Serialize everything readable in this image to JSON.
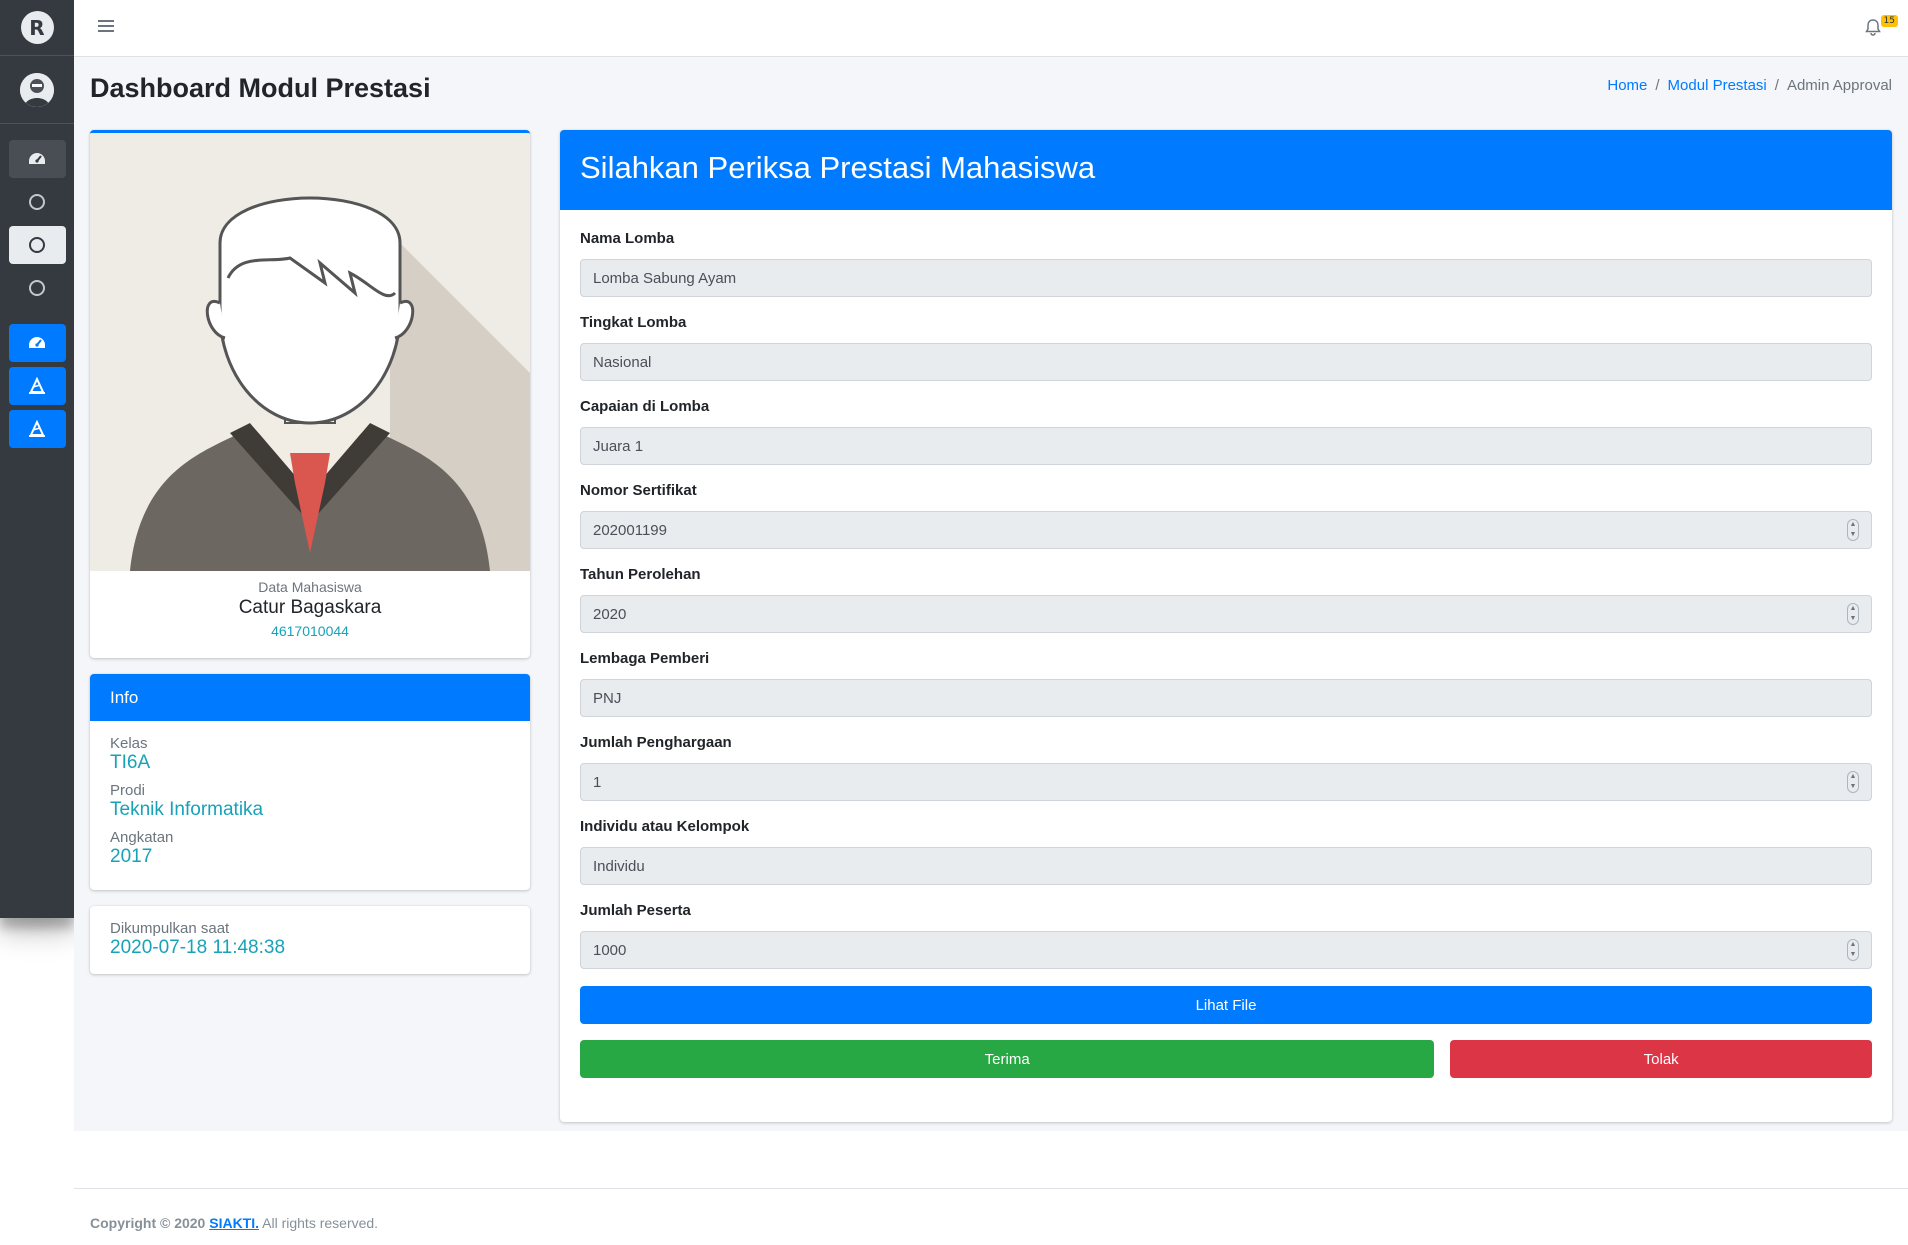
{
  "sidebar": {
    "brand_letter": "R",
    "nav_icons": [
      "dashboard-icon",
      "circle-icon",
      "circle-icon",
      "circle-icon",
      "dashboard-icon",
      "prize-icon",
      "prize-icon"
    ]
  },
  "topbar": {
    "notification_count": "15"
  },
  "page": {
    "title": "Dashboard Modul Prestasi",
    "breadcrumb": [
      "Home",
      "Modul Prestasi",
      "Admin Approval"
    ]
  },
  "profile": {
    "subtitle": "Data Mahasiswa",
    "name": "Catur Bagaskara",
    "nim": "4617010044"
  },
  "info": {
    "header": "Info",
    "fields": [
      {
        "label": "Kelas",
        "value": "TI6A"
      },
      {
        "label": "Prodi",
        "value": "Teknik Informatika"
      },
      {
        "label": "Angkatan",
        "value": "2017"
      }
    ]
  },
  "submitted": {
    "label": "Dikumpulkan saat",
    "value": "2020-07-18 11:48:38"
  },
  "form": {
    "header": "Silahkan Periksa Prestasi Mahasiswa",
    "fields": [
      {
        "label": "Nama Lomba",
        "value": "Lomba Sabung Ayam",
        "numeric": false
      },
      {
        "label": "Tingkat Lomba",
        "value": "Nasional",
        "numeric": false
      },
      {
        "label": "Capaian di Lomba",
        "value": "Juara 1",
        "numeric": false
      },
      {
        "label": "Nomor Sertifikat",
        "value": "202001199",
        "numeric": true
      },
      {
        "label": "Tahun Perolehan",
        "value": "2020",
        "numeric": true
      },
      {
        "label": "Lembaga Pemberi",
        "value": "PNJ",
        "numeric": false
      },
      {
        "label": "Jumlah Penghargaan",
        "value": "1",
        "numeric": true
      },
      {
        "label": "Individu atau Kelompok",
        "value": "Individu",
        "numeric": false
      },
      {
        "label": "Jumlah Peserta",
        "value": "1000",
        "numeric": true
      }
    ],
    "view_file_label": "Lihat File",
    "accept_label": "Terima",
    "reject_label": "Tolak"
  },
  "footer": {
    "prefix": "Copyright © 2020 ",
    "brand": "SIAKTI.",
    "suffix": " All rights reserved."
  },
  "colors": {
    "primary": "#007bff",
    "success": "#28a745",
    "danger": "#dc3545",
    "sidebar": "#343a40",
    "info_text": "#17a2b8"
  }
}
